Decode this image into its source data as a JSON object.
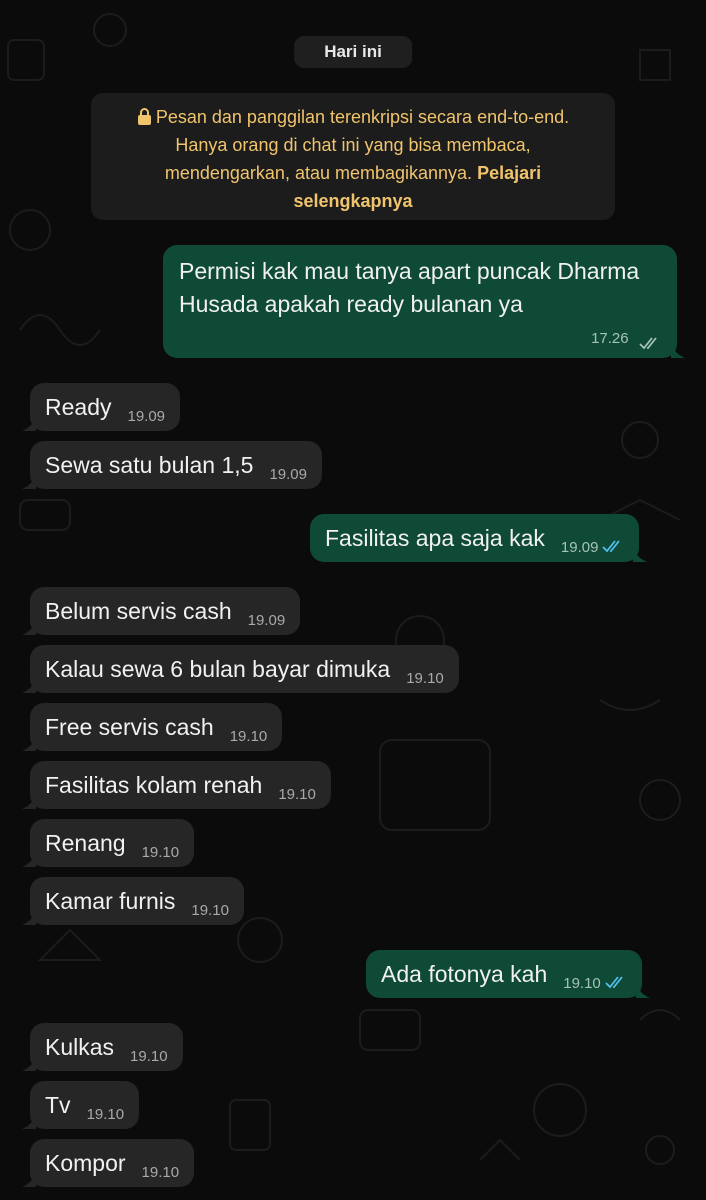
{
  "date_chip": "Hari ini",
  "encryption_notice": {
    "text": "Pesan dan panggilan terenkripsi secara end-to-end. Hanya orang di chat ini yang bisa membaca, mendengarkan, atau membagikannya.",
    "link": "Pelajari selengkapnya"
  },
  "messages": [
    {
      "dir": "out",
      "text": "Permisi kak mau tanya apart puncak Dharma Husada apakah ready bulanan ya",
      "time": "17.26"
    },
    {
      "dir": "in",
      "text": "Ready",
      "time": "19.09"
    },
    {
      "dir": "in",
      "text": "Sewa satu bulan 1,5",
      "time": "19.09"
    },
    {
      "dir": "out",
      "text": "Fasilitas apa saja kak",
      "time": "19.09"
    },
    {
      "dir": "in",
      "text": "Belum servis cash",
      "time": "19.09"
    },
    {
      "dir": "in",
      "text": "Kalau sewa 6 bulan bayar dimuka",
      "time": "19.10"
    },
    {
      "dir": "in",
      "text": "Free servis cash",
      "time": "19.10"
    },
    {
      "dir": "in",
      "text": "Fasilitas kolam renah",
      "time": "19.10"
    },
    {
      "dir": "in",
      "text": "Renang",
      "time": "19.10"
    },
    {
      "dir": "in",
      "text": "Kamar furnis",
      "time": "19.10"
    },
    {
      "dir": "out",
      "text": "Ada fotonya kah",
      "time": "19.10"
    },
    {
      "dir": "in",
      "text": "Kulkas",
      "time": "19.10"
    },
    {
      "dir": "in",
      "text": "Tv",
      "time": "19.10"
    },
    {
      "dir": "in",
      "text": "Kompor",
      "time": "19.10"
    }
  ],
  "colors": {
    "background": "#0b0b0b",
    "incoming_bubble": "#262626",
    "outgoing_bubble": "#0e4a36",
    "notice_text": "#f0c46c",
    "read_tick": "#53bdeb",
    "sent_tick": "#a7c2b8"
  },
  "icons": {
    "lock": "lock-icon",
    "read_receipt": "double-check-icon"
  }
}
